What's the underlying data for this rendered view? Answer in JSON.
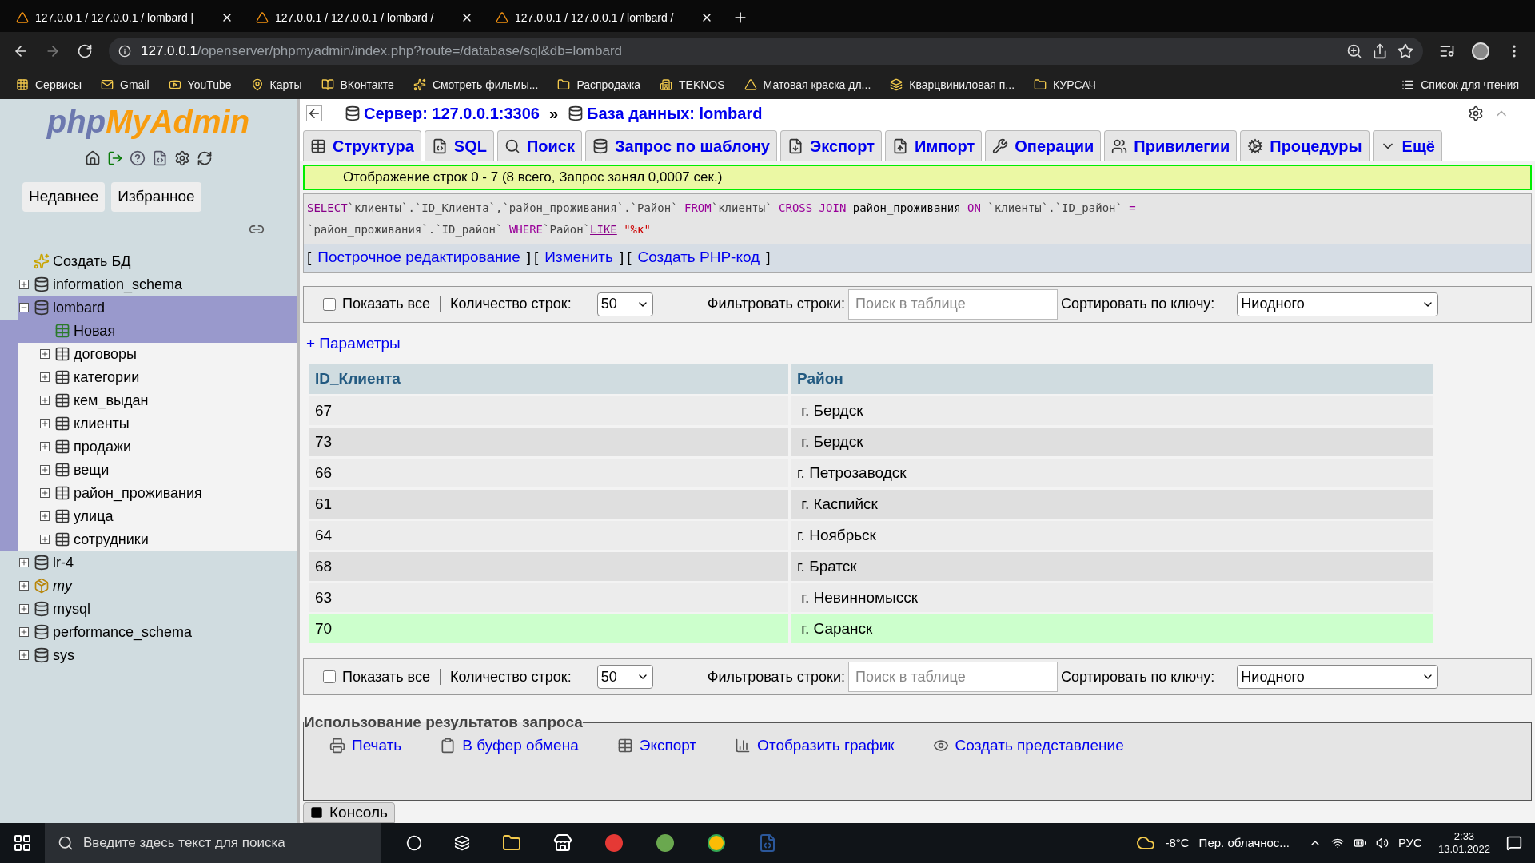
{
  "browser": {
    "tabs": [
      {
        "title": "127.0.0.1 / 127.0.0.1 / lombard | "
      },
      {
        "title": "127.0.0.1 / 127.0.0.1 / lombard / "
      },
      {
        "title": "127.0.0.1 / 127.0.0.1 / lombard / "
      }
    ],
    "address_host": "127.0.0.1",
    "address_path": "/openserver/phpmyadmin/index.php?route=/database/sql&db=lombard",
    "bookmarks": [
      {
        "label": "Сервисы"
      },
      {
        "label": "Gmail"
      },
      {
        "label": "YouTube"
      },
      {
        "label": "Карты"
      },
      {
        "label": "ВКонтакте"
      },
      {
        "label": "Смотреть фильмы..."
      },
      {
        "label": "Распродажа"
      },
      {
        "label": "TEKNOS"
      },
      {
        "label": "Матовая краска дл..."
      },
      {
        "label": "Кварцвиниловая п..."
      },
      {
        "label": "КУРСАЧ"
      }
    ],
    "reading_list": "Список для чтения"
  },
  "sidebar": {
    "logo_php": "php",
    "logo_rest": "MyAdmin",
    "buttons": [
      "Недавнее",
      "Избранное"
    ],
    "tree": [
      {
        "label": "Создать БД",
        "kind": "create",
        "selected": false
      },
      {
        "label": "information_schema",
        "kind": "database",
        "expanded": false,
        "selected": false
      },
      {
        "label": "lombard",
        "kind": "database",
        "expanded": true,
        "selected": true,
        "children": [
          {
            "label": "Новая",
            "kind": "new-table",
            "selected": false
          },
          {
            "label": "договоры",
            "kind": "table",
            "expanded": false,
            "selected": false
          },
          {
            "label": "категории",
            "kind": "table",
            "expanded": false,
            "selected": false
          },
          {
            "label": "кем_выдан",
            "kind": "table",
            "expanded": false,
            "selected": false
          },
          {
            "label": "клиенты",
            "kind": "table",
            "expanded": false,
            "selected": false
          },
          {
            "label": "продажи",
            "kind": "table",
            "expanded": false,
            "selected": false
          },
          {
            "label": "вещи",
            "kind": "table",
            "expanded": false,
            "selected": false
          },
          {
            "label": "район_проживания",
            "kind": "table",
            "expanded": false,
            "selected": false
          },
          {
            "label": "улица",
            "kind": "table",
            "expanded": false,
            "selected": false
          },
          {
            "label": "сотрудники",
            "kind": "table",
            "expanded": false,
            "selected": false
          }
        ]
      },
      {
        "label": "lr-4",
        "kind": "database",
        "expanded": false,
        "selected": false
      },
      {
        "label": "my",
        "kind": "special",
        "expanded": false,
        "selected": false
      },
      {
        "label": "mysql",
        "kind": "database",
        "expanded": false,
        "selected": false
      },
      {
        "label": "performance_schema",
        "kind": "database",
        "expanded": false,
        "selected": false
      },
      {
        "label": "sys",
        "kind": "database",
        "expanded": false,
        "selected": false
      }
    ]
  },
  "breadcrumb": {
    "server": "Сервер: 127.0.0.1:3306",
    "separator": "»",
    "database": "База данных: lombard"
  },
  "tabs": [
    {
      "label": "Структура"
    },
    {
      "label": "SQL"
    },
    {
      "label": "Поиск"
    },
    {
      "label": "Запрос по шаблону"
    },
    {
      "label": "Экспорт"
    },
    {
      "label": "Импорт"
    },
    {
      "label": "Операции"
    },
    {
      "label": "Привилегии"
    },
    {
      "label": "Процедуры"
    },
    {
      "label": "Ещё"
    }
  ],
  "message": "Отображение строк 0 - 7 (8 всего, Запрос занял 0,0007 сек.)",
  "sql_lines": [
    [
      {
        "text": "SELECT",
        "kind": "link"
      },
      {
        "text": "`клиенты`.`ID_Клиента`,`район_проживания`.`Район` ",
        "kind": "ident"
      },
      {
        "text": "FROM",
        "kind": "keyword"
      },
      {
        "text": "`клиенты` ",
        "kind": "ident"
      },
      {
        "text": "CROSS JOIN ",
        "kind": "keyword"
      },
      {
        "text": "район_проживания ",
        "kind": "plain"
      },
      {
        "text": "ON ",
        "kind": "keyword"
      },
      {
        "text": "`клиенты`.`ID_район` ",
        "kind": "ident"
      },
      {
        "text": "=",
        "kind": "keyword"
      }
    ],
    [
      {
        "text": "`район_проживания`.`ID_район` ",
        "kind": "ident"
      },
      {
        "text": "WHERE",
        "kind": "keyword"
      },
      {
        "text": "`Район`",
        "kind": "ident"
      },
      {
        "text": "LIKE",
        "kind": "link"
      },
      {
        "text": "\"%к\"",
        "kind": "string"
      }
    ]
  ],
  "sql_links": [
    {
      "open": "[",
      "label": "Построчное редактирование",
      "close": "]"
    },
    {
      "open": "[",
      "label": "Изменить",
      "close": "]"
    },
    {
      "open": "[",
      "label": "Создать PHP-код",
      "close": "]"
    }
  ],
  "controls": [
    {
      "show_all": "Показать все",
      "checked": false,
      "rows_label": "Количество строк:",
      "rows_value": "50",
      "filter_label": "Фильтровать строки:",
      "filter_placeholder": "Поиск в таблице",
      "sort_label": "Сортировать по ключу:",
      "sort_value": "Ниодного"
    },
    {
      "show_all": "Показать все",
      "checked": false,
      "rows_label": "Количество строк:",
      "rows_value": "50",
      "filter_label": "Фильтровать строки:",
      "filter_placeholder": "Поиск в таблице",
      "sort_label": "Сортировать по ключу:",
      "sort_value": "Ниодного"
    }
  ],
  "params_link": "+ Параметры",
  "table": {
    "columns": [
      "ID_Клиента",
      "Район"
    ],
    "rows": [
      {
        "cells": [
          "67",
          " г. Бердск"
        ],
        "marked": false
      },
      {
        "cells": [
          "73",
          " г. Бердск"
        ],
        "marked": false
      },
      {
        "cells": [
          "66",
          "г. Петрозаводск"
        ],
        "marked": false
      },
      {
        "cells": [
          "61",
          " г. Каспийск"
        ],
        "marked": false
      },
      {
        "cells": [
          "64",
          "г. Ноябрьск"
        ],
        "marked": false
      },
      {
        "cells": [
          "68",
          "г. Братск"
        ],
        "marked": false
      },
      {
        "cells": [
          "63",
          " г. Невинномысск"
        ],
        "marked": false
      },
      {
        "cells": [
          "70",
          " г. Саранск"
        ],
        "marked": true
      }
    ]
  },
  "query_results": {
    "legend": "Использование результатов запроса",
    "actions": [
      {
        "label": "Печать",
        "kind": "print"
      },
      {
        "label": "В буфер обмена",
        "kind": "clipboard"
      },
      {
        "label": "Экспорт",
        "kind": "export"
      },
      {
        "label": "Отобразить график",
        "kind": "chart"
      },
      {
        "label": "Создать представление",
        "kind": "view"
      }
    ]
  },
  "console": "Консоль",
  "taskbar": {
    "search_placeholder": "Введите здесь текст для поиска",
    "temperature": "-8°C",
    "weather": "Пер. облачнос...",
    "language": "РУС",
    "time": "2:33",
    "date": "13.01.2022"
  }
}
